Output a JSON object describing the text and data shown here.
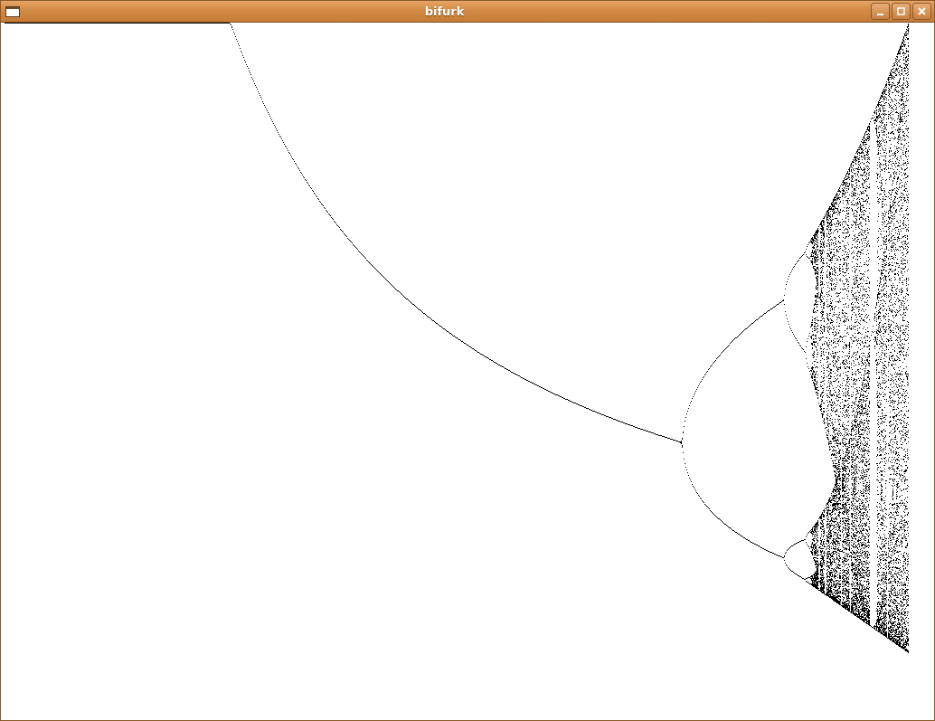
{
  "window": {
    "title": "bifurk"
  }
}
